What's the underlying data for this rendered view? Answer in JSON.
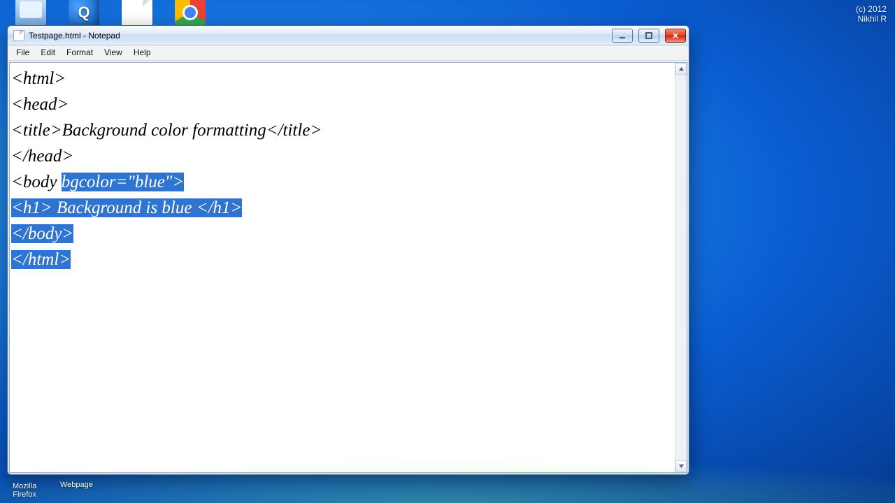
{
  "watermark": {
    "line1": "(c) 2012",
    "line2": "Nikhil R"
  },
  "desktop_icons": {
    "firefox_label_l1": "Mozilla",
    "firefox_label_l2": "Firefox",
    "webpage_label": "Webpage"
  },
  "window": {
    "title": "Testpage.html - Notepad",
    "menus": {
      "file": "File",
      "edit": "Edit",
      "format": "Format",
      "view": "View",
      "help": "Help"
    }
  },
  "code": {
    "l1": "<html>",
    "l2": "<head>",
    "l3": "<title>Background color formatting</title>",
    "l4": "</head>",
    "l5a": "<body ",
    "l5b": "bgcolor=\"blue\">",
    "l6": "<h1> Background is blue </h1>",
    "l7": "</body>",
    "l8": "</html>"
  }
}
